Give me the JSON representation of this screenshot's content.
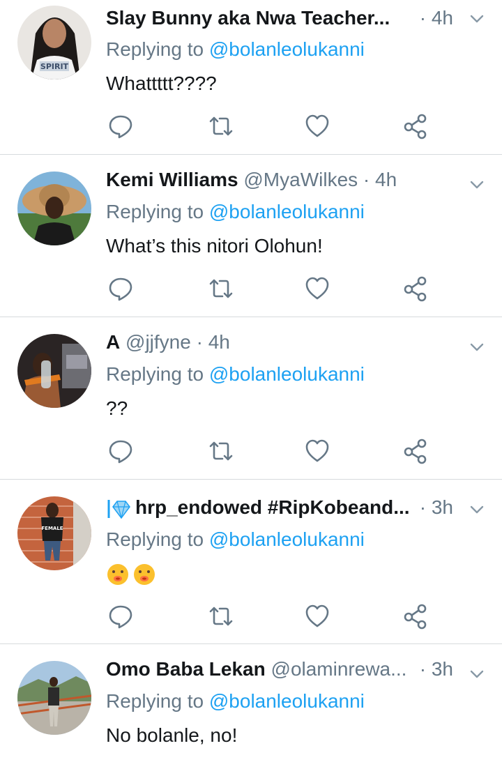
{
  "colors": {
    "accent": "#1da1f2",
    "muted": "#657786",
    "text": "#14171a",
    "divider": "#d6dadd"
  },
  "icons": {
    "reply": "reply-icon",
    "retweet": "retweet-icon",
    "like": "heart-icon",
    "share": "share-icon",
    "more": "chevron-down-icon"
  },
  "tweets": [
    {
      "name": "Slay Bunny aka Nwa Teacher...",
      "handle": "",
      "time": "· 4h",
      "replying_prefix": "Replying to ",
      "replying_to": "@bolanleolukanni",
      "text": "Whattttt????"
    },
    {
      "name": "Kemi Williams",
      "handle": "@MyaWilkes",
      "time": "· 4h",
      "replying_prefix": "Replying to ",
      "replying_to": "@bolanleolukanni",
      "text": "What’s this nitori Olohun!"
    },
    {
      "name": "A",
      "handle": "@jjfyne",
      "time": "· 4h",
      "replying_prefix": "Replying to ",
      "replying_to": "@bolanleolukanni",
      "text": "??"
    },
    {
      "name": "hrp_endowed #RipKobeand...",
      "handle": "",
      "time": "· 3h",
      "replying_prefix": "Replying to ",
      "replying_to": "@bolanleolukanni",
      "text": ""
    },
    {
      "name": "Omo Baba Lekan",
      "handle": "@olaminrewa...",
      "time": "· 3h",
      "replying_prefix": "Replying to ",
      "replying_to": "@bolanleolukanni",
      "text": "No bolanle, no!"
    }
  ]
}
